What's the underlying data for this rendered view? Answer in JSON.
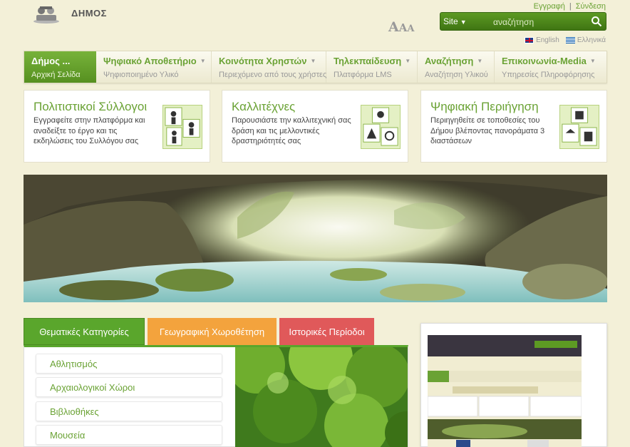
{
  "header": {
    "site_name": "ΔΗΜΟΣ",
    "register": "Εγγραφή",
    "login": "Σύνδεση",
    "font_sizes": [
      "A",
      "A",
      "A"
    ],
    "search_scope": "Site",
    "search_placeholder": "αναζήτηση",
    "lang_en": "English",
    "lang_gr": "Ελληνικά"
  },
  "nav": [
    {
      "title": "Δήμος ...",
      "subtitle": "Αρχική Σελίδα",
      "active": true
    },
    {
      "title": "Ψηφιακό Αποθετήριο",
      "subtitle": "Ψηφιοποιημένο Υλικό"
    },
    {
      "title": "Κοινότητα Χρηστών",
      "subtitle": "Περιεχόμενο από τους χρήστες"
    },
    {
      "title": "Τηλεκπαίδευση",
      "subtitle": "Πλατφόρμα LMS"
    },
    {
      "title": "Αναζήτηση",
      "subtitle": "Αναζήτηση Υλικού"
    },
    {
      "title": "Επικοινωνία-Media",
      "subtitle": "Υπηρεσίες Πληροφόρησης"
    }
  ],
  "cards": [
    {
      "title": "Πολιτιστικοί Σύλλογοι",
      "text": "Εγγραφείτε στην πλατφόρμα και αναδείξτε το έργο και τις εκδηλώσεις του Συλλόγου σας"
    },
    {
      "title": "Καλλιτέχνες",
      "text": "Παρουσιάστε την καλλιτεχνική σας δράση και τις μελλοντικές δραστηριότητές σας"
    },
    {
      "title": "Ψηφιακή Περιήγηση",
      "text": "Περιηγηθείτε σε τοποθεσίες του Δήμου βλέποντας πανοράματα 3 διαστάσεων"
    }
  ],
  "tabs": [
    "Θεματικές Κατηγορίες",
    "Γεωγραφική Χωροθέτηση",
    "Ιστορικές Περίοδοι"
  ],
  "categories": [
    "Αθλητισμός",
    "Αρχαιολογικοί Χώροι",
    "Βιβλιοθήκες",
    "Μουσεία"
  ],
  "colors": {
    "accent": "#6aa234",
    "orange": "#f3a33d",
    "red": "#e0595a",
    "background": "#f3f0d8"
  }
}
